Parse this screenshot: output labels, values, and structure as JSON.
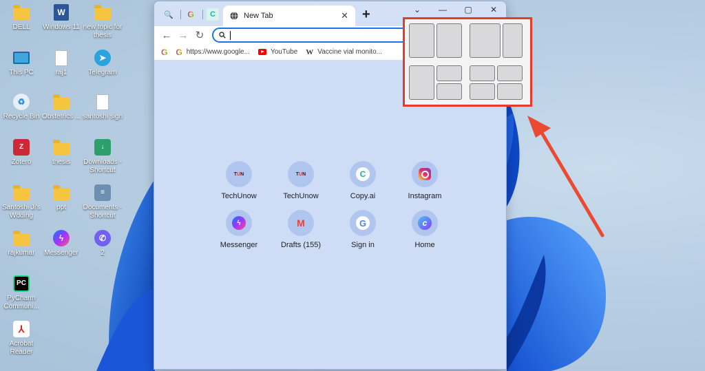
{
  "desktop": {
    "icons": [
      {
        "label": "DELL"
      },
      {
        "label": "Windows 11"
      },
      {
        "label": "new topic for thesis"
      },
      {
        "label": "This PC"
      },
      {
        "label": "raj1"
      },
      {
        "label": "Telegram"
      },
      {
        "label": "Recycle Bin"
      },
      {
        "label": "Obstetrics ..."
      },
      {
        "label": "santoshi sign"
      },
      {
        "label": "Zotero"
      },
      {
        "label": "thesis"
      },
      {
        "label": "Downloads - Shortcut"
      },
      {
        "label": "Santoshi Ji's Wdding"
      },
      {
        "label": "ppt"
      },
      {
        "label": "Documents - Shortcut"
      },
      {
        "label": "rajkumar"
      },
      {
        "label": "Messenger"
      },
      {
        "label": "2"
      },
      {
        "label": "PyCharm Communi..."
      },
      {
        "label": "Acrobat Reader"
      }
    ]
  },
  "browser": {
    "active_tab_title": "New Tab",
    "omnibox_value": "",
    "bookmarks": [
      {
        "label": "https://www.google..."
      },
      {
        "label": "YouTube"
      },
      {
        "label": "Vaccine vial monito..."
      }
    ],
    "shortcuts": [
      {
        "label": "TechUnow"
      },
      {
        "label": "TechUnow"
      },
      {
        "label": "Copy.ai"
      },
      {
        "label": "Instagram"
      },
      {
        "label": "Messenger"
      },
      {
        "label": "Drafts (155)"
      },
      {
        "label": "Sign in"
      },
      {
        "label": "Home"
      }
    ]
  },
  "colors": {
    "highlight": "#e53b2c",
    "accent": "#1a73e8"
  }
}
